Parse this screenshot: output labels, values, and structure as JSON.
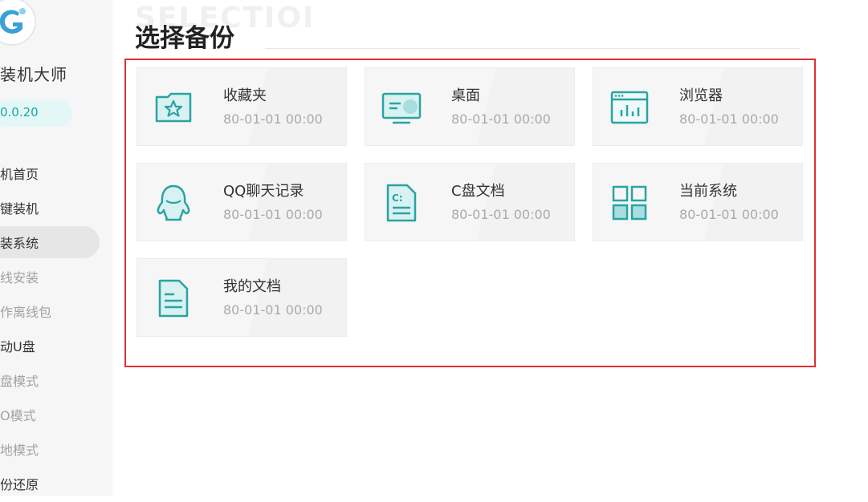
{
  "sidebar": {
    "app_name": "装机大师",
    "version": "0.0.20",
    "items": [
      {
        "label": "机首页",
        "style": "normal"
      },
      {
        "label": "键装机",
        "style": "normal"
      },
      {
        "label": "装系统",
        "style": "active"
      },
      {
        "label": "线安装",
        "style": "muted"
      },
      {
        "label": "作离线包",
        "style": "muted"
      },
      {
        "label": "动U盘",
        "style": "normal"
      },
      {
        "label": "盘模式",
        "style": "muted"
      },
      {
        "label": "O模式",
        "style": "muted"
      },
      {
        "label": "地模式",
        "style": "muted"
      },
      {
        "label": "份还原",
        "style": "normal"
      }
    ]
  },
  "header": {
    "bg_title": "SELECTIOI",
    "title": "选择备份"
  },
  "cards": [
    {
      "name": "收藏夹",
      "time": "80-01-01 00:00",
      "icon": "favorites-star-icon"
    },
    {
      "name": "桌面",
      "time": "80-01-01 00:00",
      "icon": "desktop-monitor-icon"
    },
    {
      "name": "浏览器",
      "time": "80-01-01 00:00",
      "icon": "browser-window-icon"
    },
    {
      "name": "QQ聊天记录",
      "time": "80-01-01 00:00",
      "icon": "qq-penguin-icon"
    },
    {
      "name": "C盘文档",
      "time": "80-01-01 00:00",
      "icon": "c-drive-document-icon"
    },
    {
      "name": "当前系统",
      "time": "80-01-01 00:00",
      "icon": "system-grid-icon"
    },
    {
      "name": "我的文档",
      "time": "80-01-01 00:00",
      "icon": "my-documents-icon"
    }
  ],
  "colors": {
    "accent": "#1aa6a6",
    "highlight_border": "#e03131"
  }
}
